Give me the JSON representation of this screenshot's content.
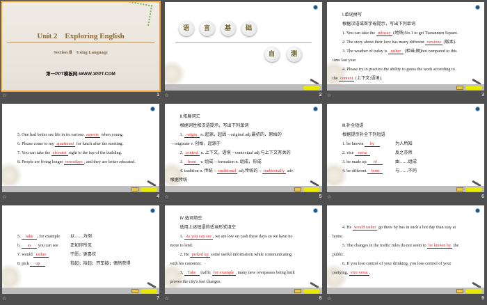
{
  "footer_icon": "☆",
  "slides": [
    {
      "num": "1",
      "title": "Unit 2　Exploring English",
      "subtitle": "Section Ⅲ　Using Language",
      "watermark": "第一PPT模板网-WWW.1PPT.COM"
    },
    {
      "num": "2",
      "circles_top": [
        "语",
        "言",
        "基",
        "础"
      ],
      "circles_bottom": [
        "自",
        "测"
      ]
    },
    {
      "num": "3",
      "lines": [
        [
          {
            "t": "Ⅰ.单词拼写"
          }
        ],
        [
          {
            "t": "根据汉语或首字母提示，写出下列单词"
          }
        ],
        [
          {
            "t": "1.  You can take the "
          },
          {
            "a": "subway"
          },
          {
            "t": " (地铁)No.1 to get Tiananmen Square."
          }
        ],
        [
          {
            "t": "2.  The story about their love has many different "
          },
          {
            "a": "versions"
          },
          {
            "t": " (版本)."
          }
        ],
        [
          {
            "t": "3. The weather of today is "
          },
          {
            "a": "rather"
          },
          {
            "t": " (相当;颇)hot compared to this"
          }
        ],
        [
          {
            "t": "time last year.",
            "o": 1
          }
        ],
        [
          {
            "t": "4.  Please try to practice the ability to guess the work according to"
          }
        ],
        [
          {
            "t": "the ",
            "o": 1
          },
          {
            "a": "context"
          },
          {
            "t": " (上下文;语境)."
          }
        ]
      ]
    },
    {
      "num": "4",
      "lines": [
        [
          {
            "t": ""
          }
        ],
        [
          {
            "t": ""
          }
        ],
        [
          {
            "t": "5.  One had better see life in its various "
          },
          {
            "a": "aspects"
          },
          {
            "t": " when young."
          }
        ],
        [
          {
            "t": "6.  Please come to my "
          },
          {
            "a": "apartment"
          },
          {
            "t": " for lunch after the meeting."
          }
        ],
        [
          {
            "t": "7.  You can take the "
          },
          {
            "a": "elevator"
          },
          {
            "t": " right to the top of the building."
          }
        ],
        [
          {
            "t": "8. People are living longer "
          },
          {
            "a": "nowadays"
          },
          {
            "t": ", and they are better educated."
          }
        ]
      ]
    },
    {
      "num": "5",
      "lines": [
        [
          {
            "t": "Ⅱ.拓展词汇"
          }
        ],
        [
          {
            "t": "根据词性和汉语提示，写出下列单词"
          }
        ],
        [
          {
            "t": "1. "
          },
          {
            "a": "origin"
          },
          {
            "t": " n. 起源，起因→original adj.最初的，原始的"
          }
        ],
        [
          {
            "t": "→originate v. 创始，起源于",
            "o": 1
          }
        ],
        [
          {
            "t": "2. "
          },
          {
            "a": "context"
          },
          {
            "t": " n. 上下文，语境→contextual adj.与上下文有关的"
          }
        ],
        [
          {
            "t": "3. "
          },
          {
            "a": "from"
          },
          {
            "t": " v. 组成→formation n. 组成，形成"
          }
        ],
        [
          {
            "t": "4. tradition n. 传统→"
          },
          {
            "a": "traditional"
          },
          {
            "t": " adj.传统的→"
          },
          {
            "a": "traditionally"
          },
          {
            "t": " adv."
          }
        ],
        [
          {
            "t": "根据传统",
            "o": 1
          }
        ]
      ]
    },
    {
      "num": "6",
      "lines": [
        [
          {
            "t": ""
          }
        ],
        [
          {
            "t": "Ⅲ.补全短语"
          }
        ],
        [
          {
            "t": "根据提示补全下列短语"
          }
        ],
        [
          {
            "t": "1.  be known "
          },
          {
            "a": "by"
          },
          {
            "c": "为人所知"
          }
        ],
        [
          {
            "t": "2.  vice "
          },
          {
            "a": "versa"
          },
          {
            "c": "反之亦然"
          }
        ],
        [
          {
            "t": "3.  be made up "
          },
          {
            "a": "of"
          },
          {
            "c": "由……组成"
          }
        ],
        [
          {
            "t": "4.  be different "
          },
          {
            "a": "from"
          },
          {
            "c": "与……不同"
          }
        ]
      ]
    },
    {
      "num": "7",
      "lines": [
        [
          {
            "t": ""
          }
        ],
        [
          {
            "t": ""
          }
        ],
        [
          {
            "t": "5. "
          },
          {
            "a": "take"
          },
          {
            "t": ", for example"
          },
          {
            "c": "以……为例"
          }
        ],
        [
          {
            "t": "6. "
          },
          {
            "a": "as"
          },
          {
            "t": " you can see"
          },
          {
            "c": "正如你所见"
          }
        ],
        [
          {
            "t": "7.  would "
          },
          {
            "a": "rather"
          },
          {
            "c": "宁愿；更喜欢"
          }
        ],
        [
          {
            "t": "8.  pick "
          },
          {
            "a": "up"
          },
          {
            "c": "捡起；拾起；开车接；偶然获得"
          }
        ]
      ]
    },
    {
      "num": "8",
      "lines": [
        [
          {
            "t": "Ⅳ.选词填空"
          }
        ],
        [
          {
            "t": "选用上述短语的适当形式填空"
          }
        ],
        [
          {
            "t": "1. "
          },
          {
            "a": "As you can see"
          },
          {
            "t": ", we are low on cash these days so we have no"
          }
        ],
        [
          {
            "t": "more to lend.",
            "o": 1
          }
        ],
        [
          {
            "t": "2. He "
          },
          {
            "a": "picked up"
          },
          {
            "t": " some useful information while communicating"
          }
        ],
        [
          {
            "t": "with his customer.",
            "o": 1
          }
        ],
        [
          {
            "t": "3. "
          },
          {
            "a": "Take"
          },
          {
            "t": " traffic "
          },
          {
            "a": "for example"
          },
          {
            "t": ", many new overpasses being built"
          }
        ],
        [
          {
            "t": "proves the city's fast changes.",
            "o": 1
          }
        ]
      ]
    },
    {
      "num": "9",
      "lines": [
        [
          {
            "t": ""
          }
        ],
        [
          {
            "t": "4. He "
          },
          {
            "a": "would rather"
          },
          {
            "t": " go there by bus in such a hot day than stay at"
          }
        ],
        [
          {
            "t": "home.",
            "o": 1
          }
        ],
        [
          {
            "t": "5. The changes in the traffic rules do not seem to "
          },
          {
            "a": "be known by"
          },
          {
            "t": " the"
          }
        ],
        [
          {
            "t": "public.",
            "o": 1
          }
        ],
        [
          {
            "t": "6. If you lose control of your drinking, you lose control of your"
          }
        ],
        [
          {
            "t": "partying, ",
            "o": 1
          },
          {
            "a": "vice versa"
          },
          {
            "t": "."
          }
        ]
      ]
    }
  ]
}
